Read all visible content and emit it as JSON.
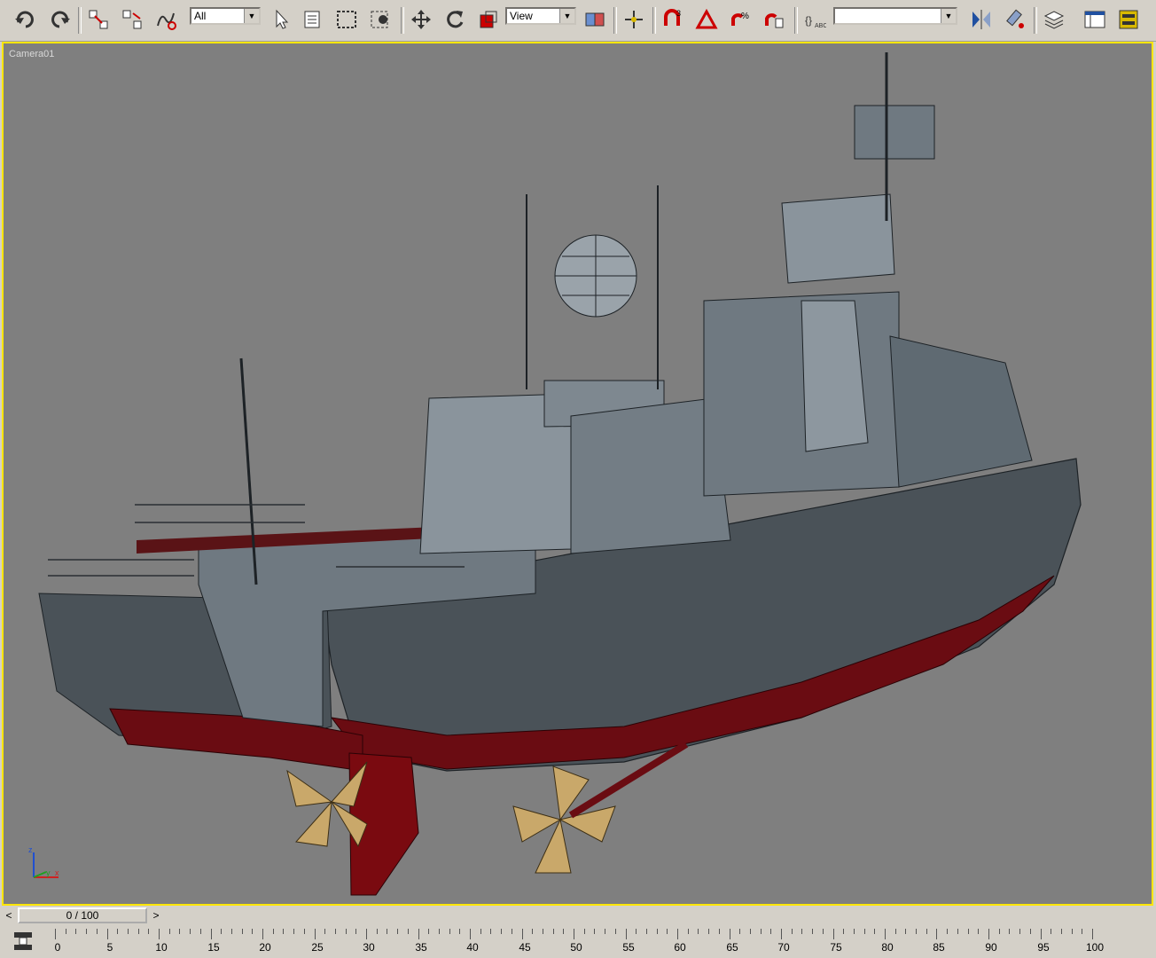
{
  "toolbar": {
    "selection_filter": "All",
    "reference_coord": "View",
    "named_selection": "",
    "tools": [
      {
        "icon": "undo-icon"
      },
      {
        "icon": "redo-icon"
      },
      {
        "icon": "select-and-link-icon"
      },
      {
        "icon": "unlink-icon"
      },
      {
        "icon": "bind-spacewarp-icon"
      },
      {
        "icon": "select-object-icon"
      },
      {
        "icon": "select-by-name-icon"
      },
      {
        "icon": "rectangular-selection-icon"
      },
      {
        "icon": "window-crossing-icon"
      },
      {
        "icon": "move-icon"
      },
      {
        "icon": "rotate-icon"
      },
      {
        "icon": "scale-icon"
      },
      {
        "icon": "use-pivot-icon"
      },
      {
        "icon": "manipulate-icon"
      },
      {
        "icon": "snap-toggle-icon"
      },
      {
        "icon": "angle-snap-icon"
      },
      {
        "icon": "percent-snap-icon"
      },
      {
        "icon": "spinner-snap-icon"
      },
      {
        "icon": "edit-named-selection-icon"
      },
      {
        "icon": "mirror-icon"
      },
      {
        "icon": "align-icon"
      },
      {
        "icon": "layer-manager-icon"
      },
      {
        "icon": "curve-editor-icon"
      },
      {
        "icon": "schematic-view-icon"
      }
    ]
  },
  "viewport": {
    "label": "Camera01",
    "border_color": "#ffe600",
    "background": "#7f7f7f",
    "axis": {
      "z": "z",
      "y": "y",
      "x": "x"
    }
  },
  "timeline": {
    "frame_display": "0 / 100",
    "prev": "<",
    "next": ">",
    "ticks": [
      "0",
      "5",
      "10",
      "15",
      "20",
      "25",
      "30",
      "35",
      "40",
      "45",
      "50",
      "55",
      "60",
      "65",
      "70",
      "75",
      "80",
      "85",
      "90",
      "95",
      "100"
    ]
  }
}
